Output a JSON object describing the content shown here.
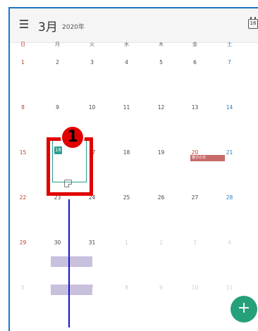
{
  "header": {
    "month": "3月",
    "year": "2020年",
    "today_icon_day": "16"
  },
  "weekdays": [
    "日",
    "月",
    "火",
    "水",
    "木",
    "金",
    "土"
  ],
  "weeks": [
    [
      "1",
      "2",
      "3",
      "4",
      "5",
      "6",
      "7"
    ],
    [
      "8",
      "9",
      "10",
      "11",
      "12",
      "13",
      "14"
    ],
    [
      "15",
      "16",
      "17",
      "18",
      "19",
      "20",
      "21"
    ],
    [
      "22",
      "23",
      "24",
      "25",
      "26",
      "27",
      "28"
    ],
    [
      "29",
      "30",
      "31",
      "1",
      "2",
      "3",
      "4"
    ],
    [
      "5",
      "6",
      "7",
      "8",
      "9",
      "10",
      "11"
    ]
  ],
  "selected_day": "16",
  "event": {
    "label": "春分の日"
  },
  "annotation": {
    "number": "1"
  },
  "fab": {
    "label": "+"
  },
  "colors": {
    "accent": "#2a9d8f",
    "highlight": "#e00000",
    "fab": "#26a07a",
    "sunday": "#c0392b",
    "saturday": "#2a7ab8"
  }
}
